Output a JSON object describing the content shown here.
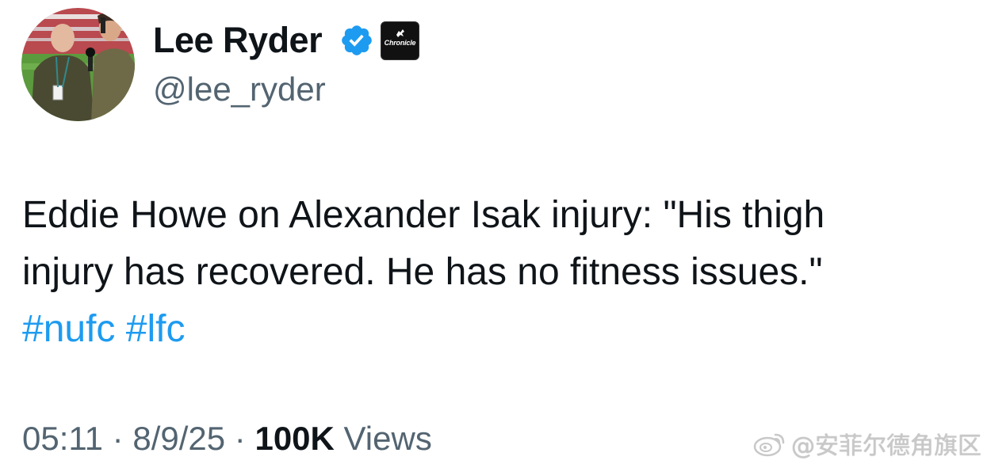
{
  "author": {
    "display_name": "Lee Ryder",
    "handle": "@lee_ryder",
    "verified_icon": "verified-badge-icon",
    "affiliate_label": "Chronicle"
  },
  "tweet": {
    "text_line_1": "Eddie Howe on Alexander Isak injury: \"His thigh",
    "text_line_2": "injury has recovered. He has no fitness issues.\"",
    "hashtag_1": "#nufc",
    "hashtag_2": "#lfc"
  },
  "meta": {
    "time": "05:11",
    "separator": "·",
    "date": "8/9/25",
    "views_count": "100K",
    "views_label": "Views"
  },
  "watermark": {
    "text": "@安菲尔德角旗区"
  },
  "colors": {
    "text_primary": "#0f1419",
    "text_secondary": "#536471",
    "link": "#1d9bf0",
    "verified": "#1d9bf0"
  }
}
